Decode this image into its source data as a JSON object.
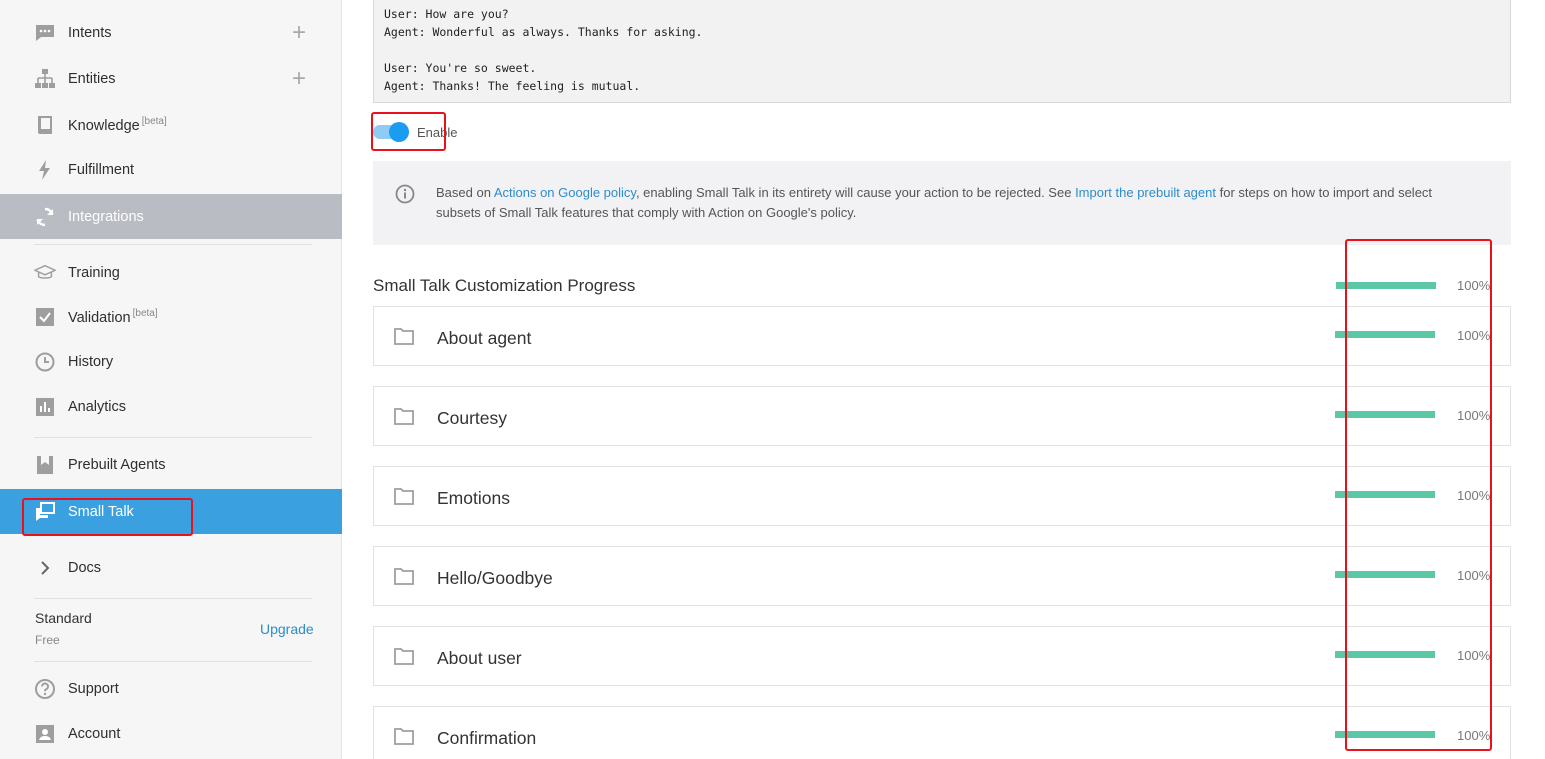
{
  "sidebar": {
    "items": [
      {
        "label": "Intents",
        "icon": "chat-icon",
        "has_add": true
      },
      {
        "label": "Entities",
        "icon": "hierarchy-icon",
        "has_add": true
      },
      {
        "label": "Knowledge",
        "badge": "[beta]",
        "icon": "book-icon"
      },
      {
        "label": "Fulfillment",
        "icon": "bolt-icon"
      },
      {
        "label": "Integrations",
        "icon": "refresh-icon"
      },
      {
        "label": "Training",
        "icon": "graduation-cap-icon"
      },
      {
        "label": "Validation",
        "badge": "[beta]",
        "icon": "check-box-icon"
      },
      {
        "label": "History",
        "icon": "clock-icon"
      },
      {
        "label": "Analytics",
        "icon": "bar-chart-icon"
      },
      {
        "label": "Prebuilt Agents",
        "icon": "bookmark-icon"
      },
      {
        "label": "Small Talk",
        "icon": "chat-bubbles-icon",
        "active": true
      },
      {
        "label": "Docs",
        "icon": "chevron-right-icon"
      },
      {
        "label": "Support",
        "icon": "help-icon"
      },
      {
        "label": "Account",
        "icon": "person-icon"
      }
    ],
    "plan": {
      "name": "Standard",
      "tier": "Free",
      "upgrade_label": "Upgrade"
    }
  },
  "main": {
    "dialog_lines": [
      "User: How are you?",
      "Agent: Wonderful as always. Thanks for asking.",
      "",
      "User: You're so sweet.",
      "Agent: Thanks! The feeling is mutual."
    ],
    "toggle": {
      "label": "Enable",
      "on": true
    },
    "info": {
      "text_before": "Based on ",
      "link1": "Actions on Google policy",
      "text_middle": ", enabling Small Talk in its entirety will cause your action to be rejected. See ",
      "link2": "Import the prebuilt agent",
      "text_after": " for steps on how to import and select subsets of Small Talk features that comply with Action on Google's policy."
    },
    "progress": {
      "title": "Small Talk Customization Progress",
      "percent_label": "100%",
      "value": 1.0
    },
    "categories": [
      {
        "name": "About agent",
        "percent_label": "100%",
        "value": 1.0
      },
      {
        "name": "Courtesy",
        "percent_label": "100%",
        "value": 1.0
      },
      {
        "name": "Emotions",
        "percent_label": "100%",
        "value": 1.0
      },
      {
        "name": "Hello/Goodbye",
        "percent_label": "100%",
        "value": 1.0
      },
      {
        "name": "About user",
        "percent_label": "100%",
        "value": 1.0
      },
      {
        "name": "Confirmation",
        "percent_label": "100%",
        "value": 1.0
      }
    ]
  },
  "colors": {
    "accent": "#3aa0e0",
    "progress_fill": "#5bc7a6",
    "highlight": "#e8121c",
    "link": "#2d8ccb"
  }
}
